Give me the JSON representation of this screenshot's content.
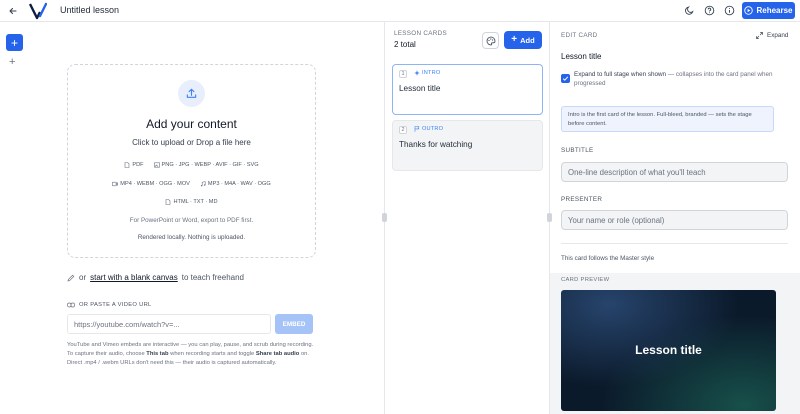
{
  "topbar": {
    "title": "Untitled lesson",
    "rehearse_label": "Rehearse",
    "icons": [
      "back-arrow-icon",
      "logo-v-icon",
      "moon-icon",
      "help-icon",
      "info-icon",
      "play-icon"
    ]
  },
  "left_rail": {
    "add_icon": "plus-icon",
    "secondary_icon": "plus-icon"
  },
  "upload": {
    "title": "Add your content",
    "subtitle": "Click to upload or Drop a file here",
    "formats": [
      {
        "icon": "file-icon",
        "label": "PDF"
      },
      {
        "icon": "image-icon",
        "label": "PNG · JPG · WEBP · AVIF · GIF · SVG"
      },
      {
        "icon": "video-icon",
        "label": "MP4 · WEBM · OGG · MOV"
      },
      {
        "icon": "audio-icon",
        "label": "MP3 · M4A · WAV · OGG"
      },
      {
        "icon": "code-icon",
        "label": "HTML · TXT · MD"
      }
    ],
    "note": "For PowerPoint or Word, export to PDF first.",
    "note2": "Rendered locally. Nothing is uploaded."
  },
  "blank": {
    "prefix": "or",
    "link": "start with a blank canvas",
    "suffix": "to teach freehand"
  },
  "video": {
    "label": "OR PASTE A VIDEO URL",
    "placeholder": "https://youtube.com/watch?v=...",
    "embed_label": "EMBED",
    "help_1": "YouTube and Vimeo embeds are interactive — you can play, pause, and scrub during recording. To capture their audio, choose ",
    "help_bold_1": "This tab",
    "help_2": " when recording starts and toggle ",
    "help_bold_2": "Share tab audio",
    "help_3": " on. Direct .mp4 / .webm URLs don't need this — their audio is captured automatically."
  },
  "cards": {
    "label": "LESSON CARDS",
    "total": "2 total",
    "add_label": "Add",
    "items": [
      {
        "num": "1",
        "tag": "INTRO",
        "title": "Lesson title",
        "selected": true
      },
      {
        "num": "2",
        "tag": "OUTRO",
        "title": "Thanks for watching",
        "selected": false
      }
    ]
  },
  "edit": {
    "label": "EDIT CARD",
    "expand_label": "Expand",
    "card_title": "Lesson title",
    "checkbox_label": "Expand to full stage when shown",
    "checkbox_hint": "— collapses into the card panel when progressed",
    "checkbox_checked": true,
    "info": "Intro is the first card of the lesson. Full-bleed, branded — sets the stage before content.",
    "subtitle_label": "SUBTITLE",
    "subtitle_placeholder": "One-line description of what you'll teach",
    "presenter_label": "PRESENTER",
    "presenter_placeholder": "Your name or role (optional)",
    "master_note": "This card follows the Master style",
    "preview_label": "CARD PREVIEW",
    "preview_title": "Lesson title"
  },
  "colors": {
    "accent": "#2563eb",
    "preview_bg": "#0b1a2b",
    "info_bg": "#eef3fd"
  }
}
